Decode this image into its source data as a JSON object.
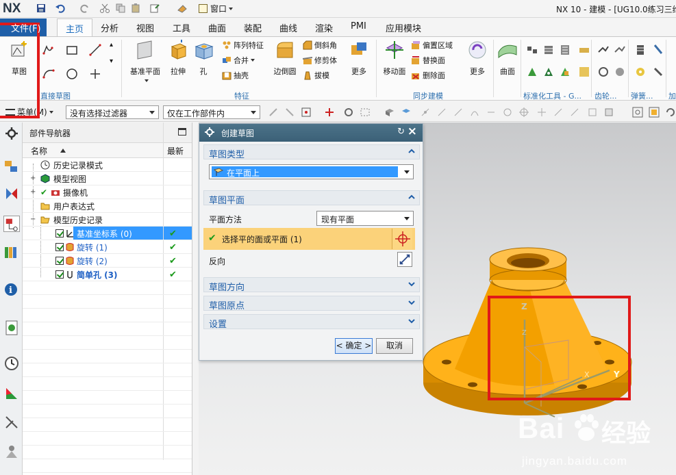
{
  "titlebar": {
    "logo": "NX",
    "window_menu": "窗口",
    "app_title": "NX 10 - 建模 - [UG10.0练习三维"
  },
  "ribbon_tabs": {
    "file": "文件(F)",
    "items": [
      "主页",
      "分析",
      "视图",
      "工具",
      "曲面",
      "装配",
      "曲线",
      "渲染",
      "PMI",
      "应用模块"
    ],
    "active": "主页"
  },
  "ribbon": {
    "sketch": "草图",
    "direct_sketch_group": "直接草图",
    "datum_plane": "基准平面",
    "extrude": "拉伸",
    "hole": "孔",
    "pattern_feature": "阵列特征",
    "unite": "合并",
    "shell": "抽壳",
    "edge_blend": "边倒圆",
    "chamfer": "倒斜角",
    "trim_body": "修剪体",
    "draft": "拔模",
    "more1": "更多",
    "feature_group": "特征",
    "move_face": "移动面",
    "offset_region": "偏置区域",
    "replace_face": "替换面",
    "delete_face": "删除面",
    "more2": "更多",
    "sync_group": "同步建模",
    "surface": "曲面",
    "std_tools_group": "标准化工具 - G...",
    "gear_group": "齿轮...",
    "spring_group": "弹簧...",
    "add_group": "加"
  },
  "selbar": {
    "menu": "菜单(M)",
    "filter": "没有选择过滤器",
    "scope": "仅在工作部件内"
  },
  "navigator": {
    "title": "部件导航器",
    "col_name": "名称",
    "col_latest": "最新",
    "rows": [
      {
        "label": "历史记录模式"
      },
      {
        "label": "模型视图"
      },
      {
        "label": "摄像机"
      },
      {
        "label": "用户表达式"
      },
      {
        "label": "模型历史记录"
      },
      {
        "label": "基准坐标系 (0)"
      },
      {
        "label": "旋转 (1)"
      },
      {
        "label": "旋转 (2)"
      },
      {
        "label": "简单孔 (3)"
      }
    ]
  },
  "dialog": {
    "title": "创建草图",
    "sec_type": "草图类型",
    "type_value": "在平面上",
    "sec_plane": "草图平面",
    "plane_method_label": "平面方法",
    "plane_method_value": "现有平面",
    "select_face": "选择平的面或平面 (1)",
    "reverse": "反向",
    "sec_direction": "草图方向",
    "sec_origin": "草图原点",
    "sec_settings": "设置",
    "ok": "< 确定 >",
    "cancel": "取消"
  },
  "graphics": {
    "axis_z": "Z",
    "axis_y": "Y",
    "axis_x": "X",
    "part_color": "#f0a30a"
  },
  "watermark": {
    "logo": "Bai",
    "text": "经验",
    "url": "jingyan.baidu.com"
  },
  "colors": {
    "accent": "#1a6bbd",
    "dialog_header": "#456b80",
    "highlight_row": "#fbd27a",
    "annotation_red": "#e01919"
  }
}
